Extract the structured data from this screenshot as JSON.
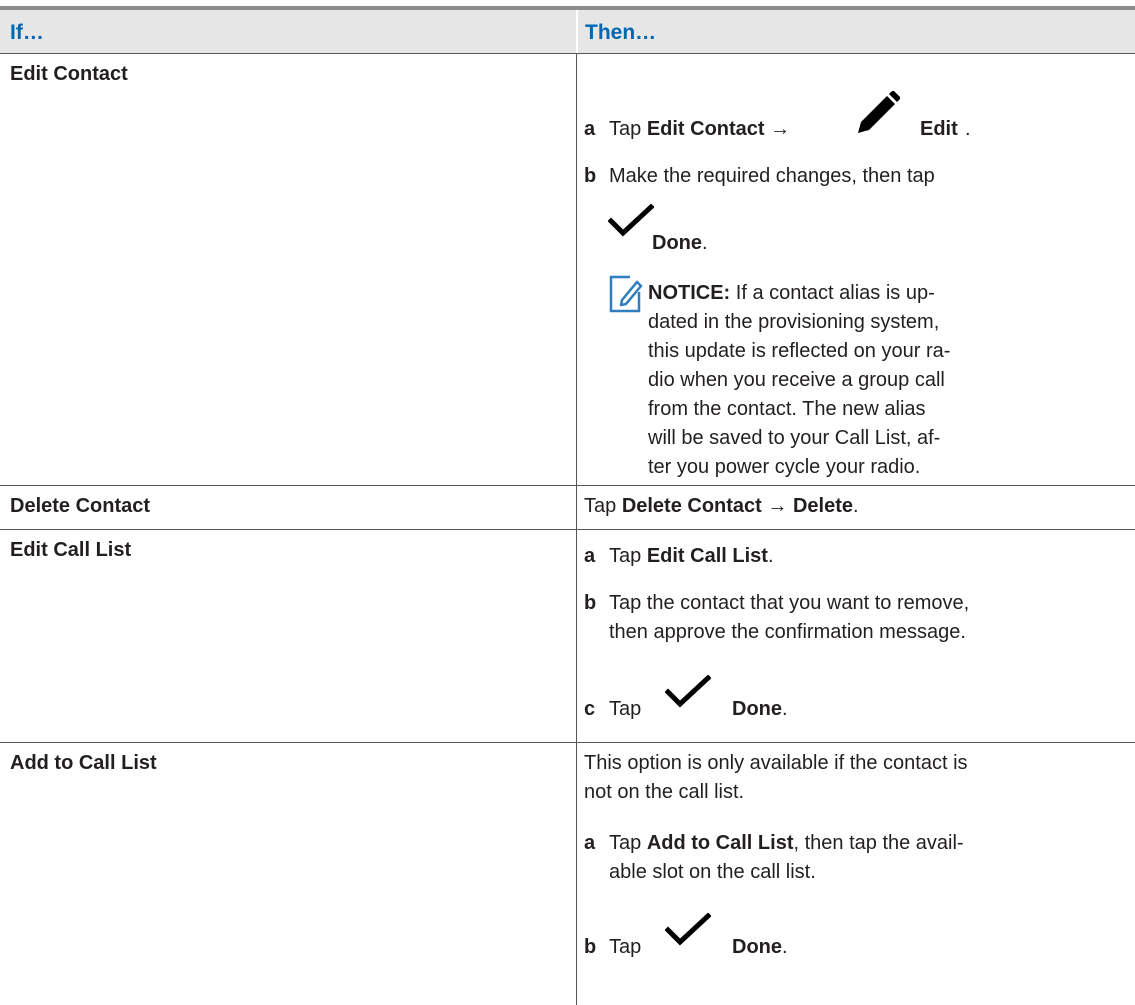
{
  "header": {
    "col_if": "If…",
    "col_then": "Then…"
  },
  "rows": {
    "edit_contact": {
      "if": "Edit Contact",
      "step_a": {
        "label": "a",
        "pre": "Tap ",
        "bold1": "Edit Contact",
        "arrow": " → ",
        "bold2": "Edit",
        "post": "."
      },
      "step_b": {
        "label": "b",
        "text": "Make the required changes, then tap",
        "bold": "Done",
        "post": "."
      },
      "notice": {
        "title": "NOTICE:",
        "lines": [
          " If a contact alias is up-",
          "dated in the provisioning system,",
          "this update is reflected on your ra-",
          "dio when you receive a group call",
          "from the contact. The new alias",
          "will be saved to your Call List, af-",
          "ter you power cycle your radio."
        ]
      }
    },
    "delete_contact": {
      "if": "Delete Contact",
      "pre": "Tap ",
      "bold1": "Delete Contact",
      "arrow": " → ",
      "bold2": "Delete",
      "post": "."
    },
    "edit_call_list": {
      "if": "Edit Call List",
      "step_a": {
        "label": "a",
        "pre": "Tap ",
        "bold": "Edit Call List",
        "post": "."
      },
      "step_b": {
        "label": "b",
        "line1": "Tap the contact that you want to remove,",
        "line2": "then approve the confirmation message."
      },
      "step_c": {
        "label": "c",
        "pre": "Tap",
        "bold": "Done",
        "post": "."
      }
    },
    "add_to_call_list": {
      "if": "Add to Call List",
      "intro_line1": "This option is only available if the contact is",
      "intro_line2": "not on the call list.",
      "step_a": {
        "label": "a",
        "pre": "Tap ",
        "bold": "Add to Call List",
        "post1": ", then tap the avail-",
        "line2": "able slot on the call list."
      },
      "step_b": {
        "label": "b",
        "pre": "Tap",
        "bold": "Done",
        "post": "."
      }
    }
  },
  "icons": [
    "pencil-icon",
    "checkmark-icon",
    "notice-icon"
  ],
  "colors": {
    "header_text": "#0067b0",
    "header_bg": "#e6e6e6",
    "notice_icon": "#2f7ec0"
  }
}
